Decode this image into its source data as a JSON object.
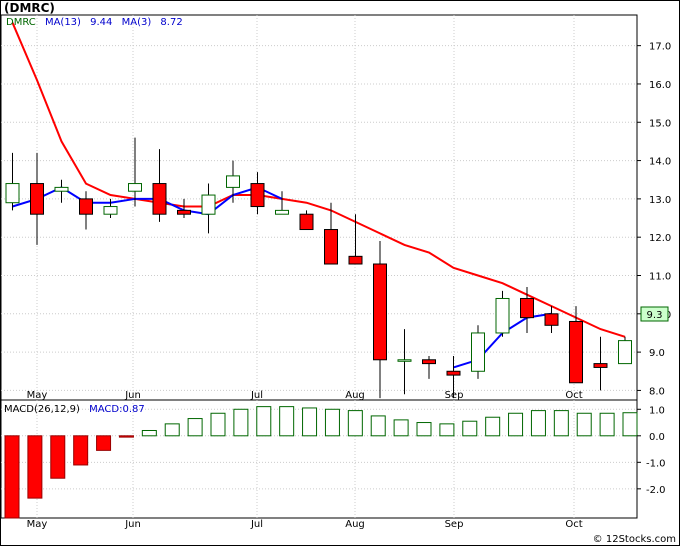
{
  "title": "(DMRC)",
  "legend": {
    "ticker": "DMRC",
    "ma13_label": "MA(13)",
    "ma13_value": "9.44",
    "ma3_label": "MA(3)",
    "ma3_value": "8.72"
  },
  "last_price_label": "9.3",
  "macd_legend": {
    "label": "MACD(26,12,9)",
    "value_label": "MACD:0.87"
  },
  "watermark": "© 12Stocks.com",
  "colors": {
    "up": "#006600",
    "down": "#ff0000",
    "ma13": "#ff0000",
    "ma3": "#0000ff",
    "price_box": "#ccffcc"
  },
  "chart_data": [
    {
      "type": "candlestick",
      "title": "(DMRC)",
      "x_labels": [
        "May",
        "Jun",
        "Jul",
        "Aug",
        "Sep",
        "Oct"
      ],
      "y_ticks": [
        8.0,
        9.0,
        10.0,
        11.0,
        12.0,
        13.0,
        14.0,
        15.0,
        16.0,
        17.0
      ],
      "ylim": [
        7.75,
        17.8
      ],
      "grid": true,
      "candles": [
        {
          "o": 12.9,
          "h": 14.2,
          "l": 12.7,
          "c": 13.4
        },
        {
          "o": 13.4,
          "h": 14.2,
          "l": 11.8,
          "c": 12.6
        },
        {
          "o": 13.2,
          "h": 13.5,
          "l": 12.9,
          "c": 13.3
        },
        {
          "o": 13.0,
          "h": 13.2,
          "l": 12.2,
          "c": 12.6
        },
        {
          "o": 12.6,
          "h": 13.0,
          "l": 12.5,
          "c": 12.8
        },
        {
          "o": 13.2,
          "h": 14.6,
          "l": 12.8,
          "c": 13.4
        },
        {
          "o": 13.4,
          "h": 14.3,
          "l": 12.4,
          "c": 12.6
        },
        {
          "o": 12.7,
          "h": 13.0,
          "l": 12.5,
          "c": 12.6
        },
        {
          "o": 12.6,
          "h": 13.4,
          "l": 12.1,
          "c": 13.1
        },
        {
          "o": 13.3,
          "h": 14.0,
          "l": 12.9,
          "c": 13.6
        },
        {
          "o": 13.4,
          "h": 13.7,
          "l": 12.6,
          "c": 12.8
        },
        {
          "o": 12.6,
          "h": 13.2,
          "l": 12.6,
          "c": 12.7
        },
        {
          "o": 12.6,
          "h": 12.7,
          "l": 12.2,
          "c": 12.2
        },
        {
          "o": 12.2,
          "h": 12.9,
          "l": 11.3,
          "c": 11.3
        },
        {
          "o": 11.5,
          "h": 12.6,
          "l": 11.3,
          "c": 11.3
        },
        {
          "o": 11.3,
          "h": 11.9,
          "l": 7.8,
          "c": 8.8
        },
        {
          "o": 8.8,
          "h": 9.6,
          "l": 7.9,
          "c": 8.8
        },
        {
          "o": 8.8,
          "h": 8.9,
          "l": 8.3,
          "c": 8.7
        },
        {
          "o": 8.5,
          "h": 8.9,
          "l": 7.8,
          "c": 8.4
        },
        {
          "o": 8.5,
          "h": 9.7,
          "l": 8.3,
          "c": 9.5
        },
        {
          "o": 9.5,
          "h": 10.6,
          "l": 9.4,
          "c": 10.4
        },
        {
          "o": 10.4,
          "h": 10.7,
          "l": 9.5,
          "c": 9.9
        },
        {
          "o": 10.0,
          "h": 10.2,
          "l": 9.5,
          "c": 9.7
        },
        {
          "o": 9.8,
          "h": 10.2,
          "l": 8.2,
          "c": 8.2
        },
        {
          "o": 8.7,
          "h": 9.4,
          "l": 8.0,
          "c": 8.6
        },
        {
          "o": 8.7,
          "h": 9.4,
          "l": 8.7,
          "c": 9.3
        }
      ],
      "series": [
        {
          "name": "MA(13)",
          "color": "#ff0000",
          "values": [
            17.6,
            16.1,
            14.5,
            13.4,
            13.1,
            13.0,
            12.9,
            12.8,
            12.8,
            13.1,
            13.1,
            13.0,
            12.9,
            12.7,
            12.4,
            12.1,
            11.8,
            11.6,
            11.2,
            11.0,
            10.8,
            10.5,
            10.2,
            9.9,
            9.6,
            9.4
          ]
        },
        {
          "name": "MA(3)",
          "color": "#0000ff",
          "values": [
            12.8,
            13.0,
            13.3,
            12.9,
            12.9,
            13.0,
            13.0,
            12.7,
            12.6,
            13.1,
            13.3,
            13.0,
            null,
            null,
            null,
            null,
            null,
            null,
            8.6,
            8.8,
            9.5,
            9.9,
            10.0,
            null,
            null,
            null
          ]
        }
      ]
    },
    {
      "type": "bar",
      "title": "MACD(26,12,9)",
      "x_labels": [
        "May",
        "Jun",
        "Jul",
        "Aug",
        "Sep",
        "Oct"
      ],
      "y_ticks": [
        -2.0,
        -1.0,
        0.0,
        1.0
      ],
      "ylim": [
        -3.1,
        1.35
      ],
      "values": [
        -3.1,
        -2.35,
        -1.6,
        -1.1,
        -0.55,
        -0.05,
        0.2,
        0.45,
        0.65,
        0.85,
        1.0,
        1.1,
        1.1,
        1.05,
        1.0,
        0.95,
        0.75,
        0.6,
        0.5,
        0.45,
        0.55,
        0.7,
        0.85,
        0.95,
        0.95,
        0.85,
        0.85,
        0.87
      ]
    }
  ]
}
